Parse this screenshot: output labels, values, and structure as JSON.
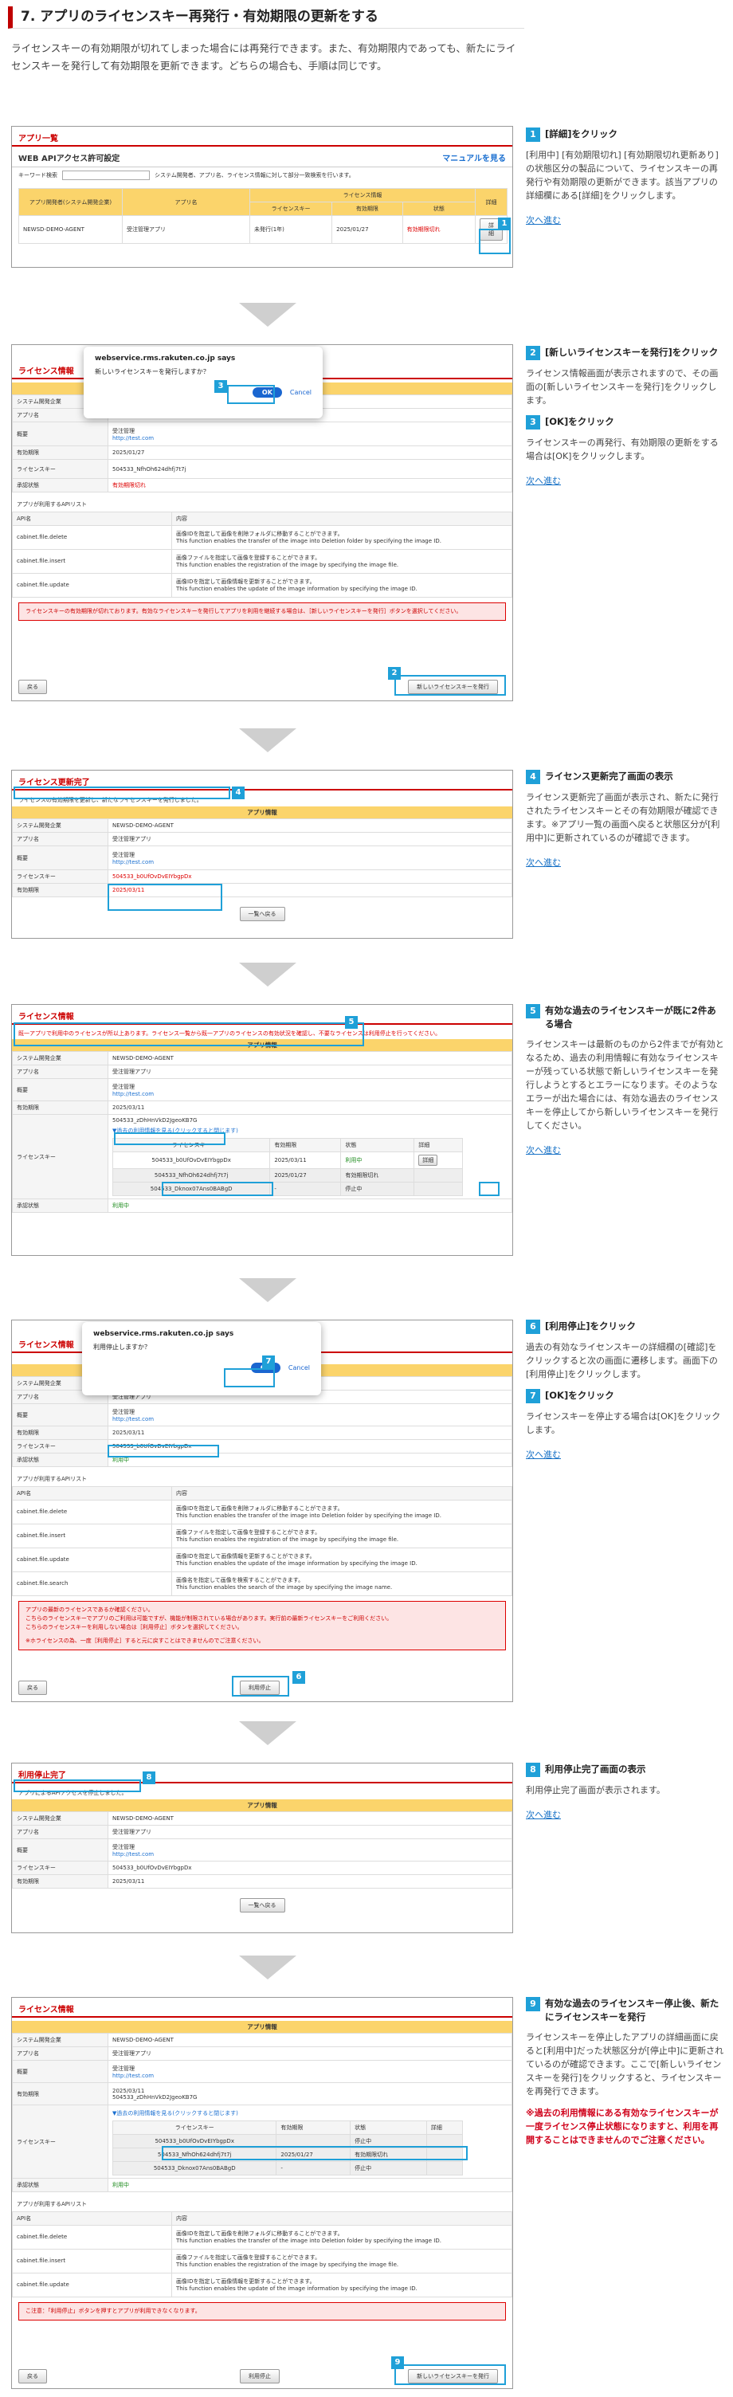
{
  "section": {
    "title": "7. アプリのライセンスキー再発行・有効期限の更新をする",
    "intro": "ライセンスキーの有効期限が切れてしまった場合には再発行できます。また、有効期限内であっても、新たにライセンスキーを発行して有効期限を更新できます。どちらの場合も、手順は同じです。"
  },
  "common": {
    "next": "次へ進む",
    "sys": "システム開発企業",
    "app": "アプリ名",
    "summary": "概要",
    "expiry": "有効期限",
    "key": "ライセンスキー",
    "approval": "承認状態",
    "sys_val": "NEWSD-DEMO-AGENT",
    "app_val": "受注管理アプリ",
    "summary_val": "受注管理",
    "url": "http://test.com",
    "api_list": "アプリが利用するAPIリスト",
    "api_col": "API名",
    "content_col": "内容",
    "back": "戻る",
    "to_list": "一覧へ戻る",
    "new_key": "新しいライセンスキーを発行",
    "stop": "利用停止",
    "dlg_title": "webservice.rms.rakuten.co.jp says",
    "ok": "OK",
    "cancel": "Cancel",
    "app_info": "アプリ情報",
    "history": "▼過去の利用情報を見る(クリックすると閉じます)",
    "status_col": "状態",
    "detail_col": "詳細",
    "detail_btn": "詳細"
  },
  "apis": [
    {
      "name": "cabinet.file.delete",
      "ja": "画像IDを指定して画像を削除フォルダに移動することができます。",
      "en": "This function enables the transfer of the image into Deletion folder by specifying the image ID."
    },
    {
      "name": "cabinet.file.insert",
      "ja": "画像ファイルを指定して画像を登録することができます。",
      "en": "This function enables the registration of the image by specifying the image file."
    },
    {
      "name": "cabinet.file.update",
      "ja": "画像IDを指定して画像情報を更新することができます。",
      "en": "This function enables the update of the image information by specifying the image ID."
    },
    {
      "name": "cabinet.file.search",
      "ja": "画像名を指定して画像を検索することができます。",
      "en": "This function enables the search of the image by specifying the image name."
    }
  ],
  "shot1": {
    "title": "アプリ一覧",
    "sub": "WEB APIアクセス許可設定",
    "manual": "マニュアルを見る",
    "kw": "キーワード検索",
    "kw_hint": "システム開発者、アプリ名、ライセンス情報に対して部分一致検索を行います。",
    "cols": [
      "アプリ開発者(システム開発企業)",
      "アプリ名",
      "ライセンス情報",
      "詳細"
    ],
    "subcols": [
      "ライセンスキー",
      "有効期限",
      "状態"
    ],
    "row": [
      "NEWSD-DEMO-AGENT",
      "受注管理アプリ",
      "未発行(1年)",
      "2025/01/27",
      "有効期限切れ"
    ]
  },
  "step1": {
    "num": "1",
    "title": "[詳細]をクリック",
    "body": "[利用中] [有効期限切れ] [有効期限切れ更新あり]の状態区分の製品について、ライセンスキーの再発行や有効期限の更新ができます。該当アプリの詳細欄にある[詳細]をクリックします。"
  },
  "shot2": {
    "title": "ライセンス情報",
    "dlg_msg": "新しいライセンスキーを発行しますか？",
    "key": "504533_NfhOh624dhfj7t7j",
    "date": "2025/01/27",
    "status": "有効期限切れ",
    "alert": "ライセンスキーの有効期限が切れております。有効なライセンスキーを発行してアプリを利用を継続する場合は、［新しいライセンスキーを発行］ボタンを選択してください。"
  },
  "step2": {
    "num": "2",
    "title": "[新しいライセンスキーを発行]をクリック",
    "body": "ライセンス情報画面が表示されますので、その画面の[新しいライセンスキーを発行]をクリックします。"
  },
  "step3": {
    "num": "3",
    "title": "[OK]をクリック",
    "body": "ライセンスキーの再発行、有効期限の更新をする場合は[OK]をクリックします。"
  },
  "shot3": {
    "title": "ライセンス更新完了",
    "msg": "ライセンスの有効期限を更新し、新たなライセンスキーを発行しました。",
    "key": "504533_b0UfOvDvEIYbgpDx",
    "date": "2025/03/11"
  },
  "step4": {
    "num": "4",
    "title": "ライセンス更新完了画面の表示",
    "body": "ライセンス更新完了画面が表示され、新たに発行されたライセンスキーとその有効期限が確認できます。※アプリ一覧の画面へ戻ると状態区分が[利用中]に更新されているのが確認できます。"
  },
  "shot4": {
    "title": "ライセンス情報",
    "warn": "既一アプリで利用中のライセンスが所以上あります。ライセンス一覧から既一アプリのライセンスの有効状況を確認し、不要なライセンスは利用停止を行ってください。",
    "date": "2025/03/11",
    "key": "504533_zDhHnVkD2JgeoKB7G",
    "hist": [
      [
        "504533_b0UfOvDvEIYbgpDx",
        "2025/03/11",
        "利用中"
      ],
      [
        "504533_NfhOh624dhfj7t7j",
        "2025/01/27",
        "有効期限切れ"
      ],
      [
        "504533_Dknox07Ans0BABgD",
        "-",
        "停止中"
      ]
    ],
    "approved": "利用中"
  },
  "step5": {
    "num": "5",
    "title": "有効な過去のライセンスキーが既に2件ある場合",
    "body": "ライセンスキーは最新のものから2件までが有効となるため、過去の利用情報に有効なライセンスキーが残っている状態で新しいライセンスキーを発行しようとするとエラーになります。そのようなエラーが出た場合には、有効な過去のライセンスキーを停止してから新しいライセンスキーを発行してください。"
  },
  "shot5": {
    "title": "ライセンス情報",
    "dlg_msg": "利用停止しますか？",
    "key": "504533_b0UfOvDvEIYbgpDx",
    "date": "2025/03/11",
    "alert1": "アプリの最新のライセンスであるか確認ください。",
    "alert2": "こちらのライセンスキーでアプリのご利用は可能ですが、機能が制限されている場合があります。実行前の最新ライセンスキーをご利用ください。",
    "alert3": "こちらのライセンスキーを利用しない場合は［利用停止］ボタンを選択してください。",
    "alert4": "※ホライセンスの為、一度［利用停止］すると元に戻すことはできませんのでご注意ください。"
  },
  "step6": {
    "num": "6",
    "title": "[利用停止]をクリック",
    "body": "過去の有効なライセンスキーの詳細欄の[確認]をクリックすると次の画面に遷移します。画面下の[利用停止]をクリックします。"
  },
  "step7": {
    "num": "7",
    "title": "[OK]をクリック",
    "body": "ライセンスキーを停止する場合は[OK]をクリックします。"
  },
  "shot6": {
    "title": "利用停止完了",
    "msg": "アプリによるAPIアクセスを停止しました。",
    "key": "504533_b0UfOvDvEIYbgpDx",
    "date": "2025/03/11"
  },
  "step8": {
    "num": "8",
    "title": "利用停止完了画面の表示",
    "body": "利用停止完了画面が表示されます。"
  },
  "shot7": {
    "title": "ライセンス情報",
    "date": "2025/03/11",
    "key": "504533_zDhHnVkD2JgeoKB7G",
    "hist": [
      [
        "504533_b0UfOvDvEIYbgpDx",
        "",
        "停止中"
      ],
      [
        "504533_NfhOh624dhfj7t7j",
        "2025/01/27",
        "有効期限切れ"
      ],
      [
        "504533_Dknox07Ans0BABgD",
        "-",
        "停止中"
      ]
    ],
    "approved": "利用中",
    "note": "こ注意：「利用停止」ボタンを押すとアプリが利用できなくなります。"
  },
  "step9": {
    "num": "9",
    "title": "有効な過去のライセンスキー停止後、新たにライセンスキーを発行",
    "body": "ライセンスキーを停止したアプリの詳細画面に戻ると[利用中]だった状態区分が[停止中]に更新されているのが確認できます。ここで[新しいライセンスキーを発行]をクリックすると、ライセンスキーを再発行できます。",
    "red": "※過去の利用情報にある有効なライセンスキーが一度ライセンス停止状態になりますと、利用を再開することはできませんのでご注意ください。"
  }
}
